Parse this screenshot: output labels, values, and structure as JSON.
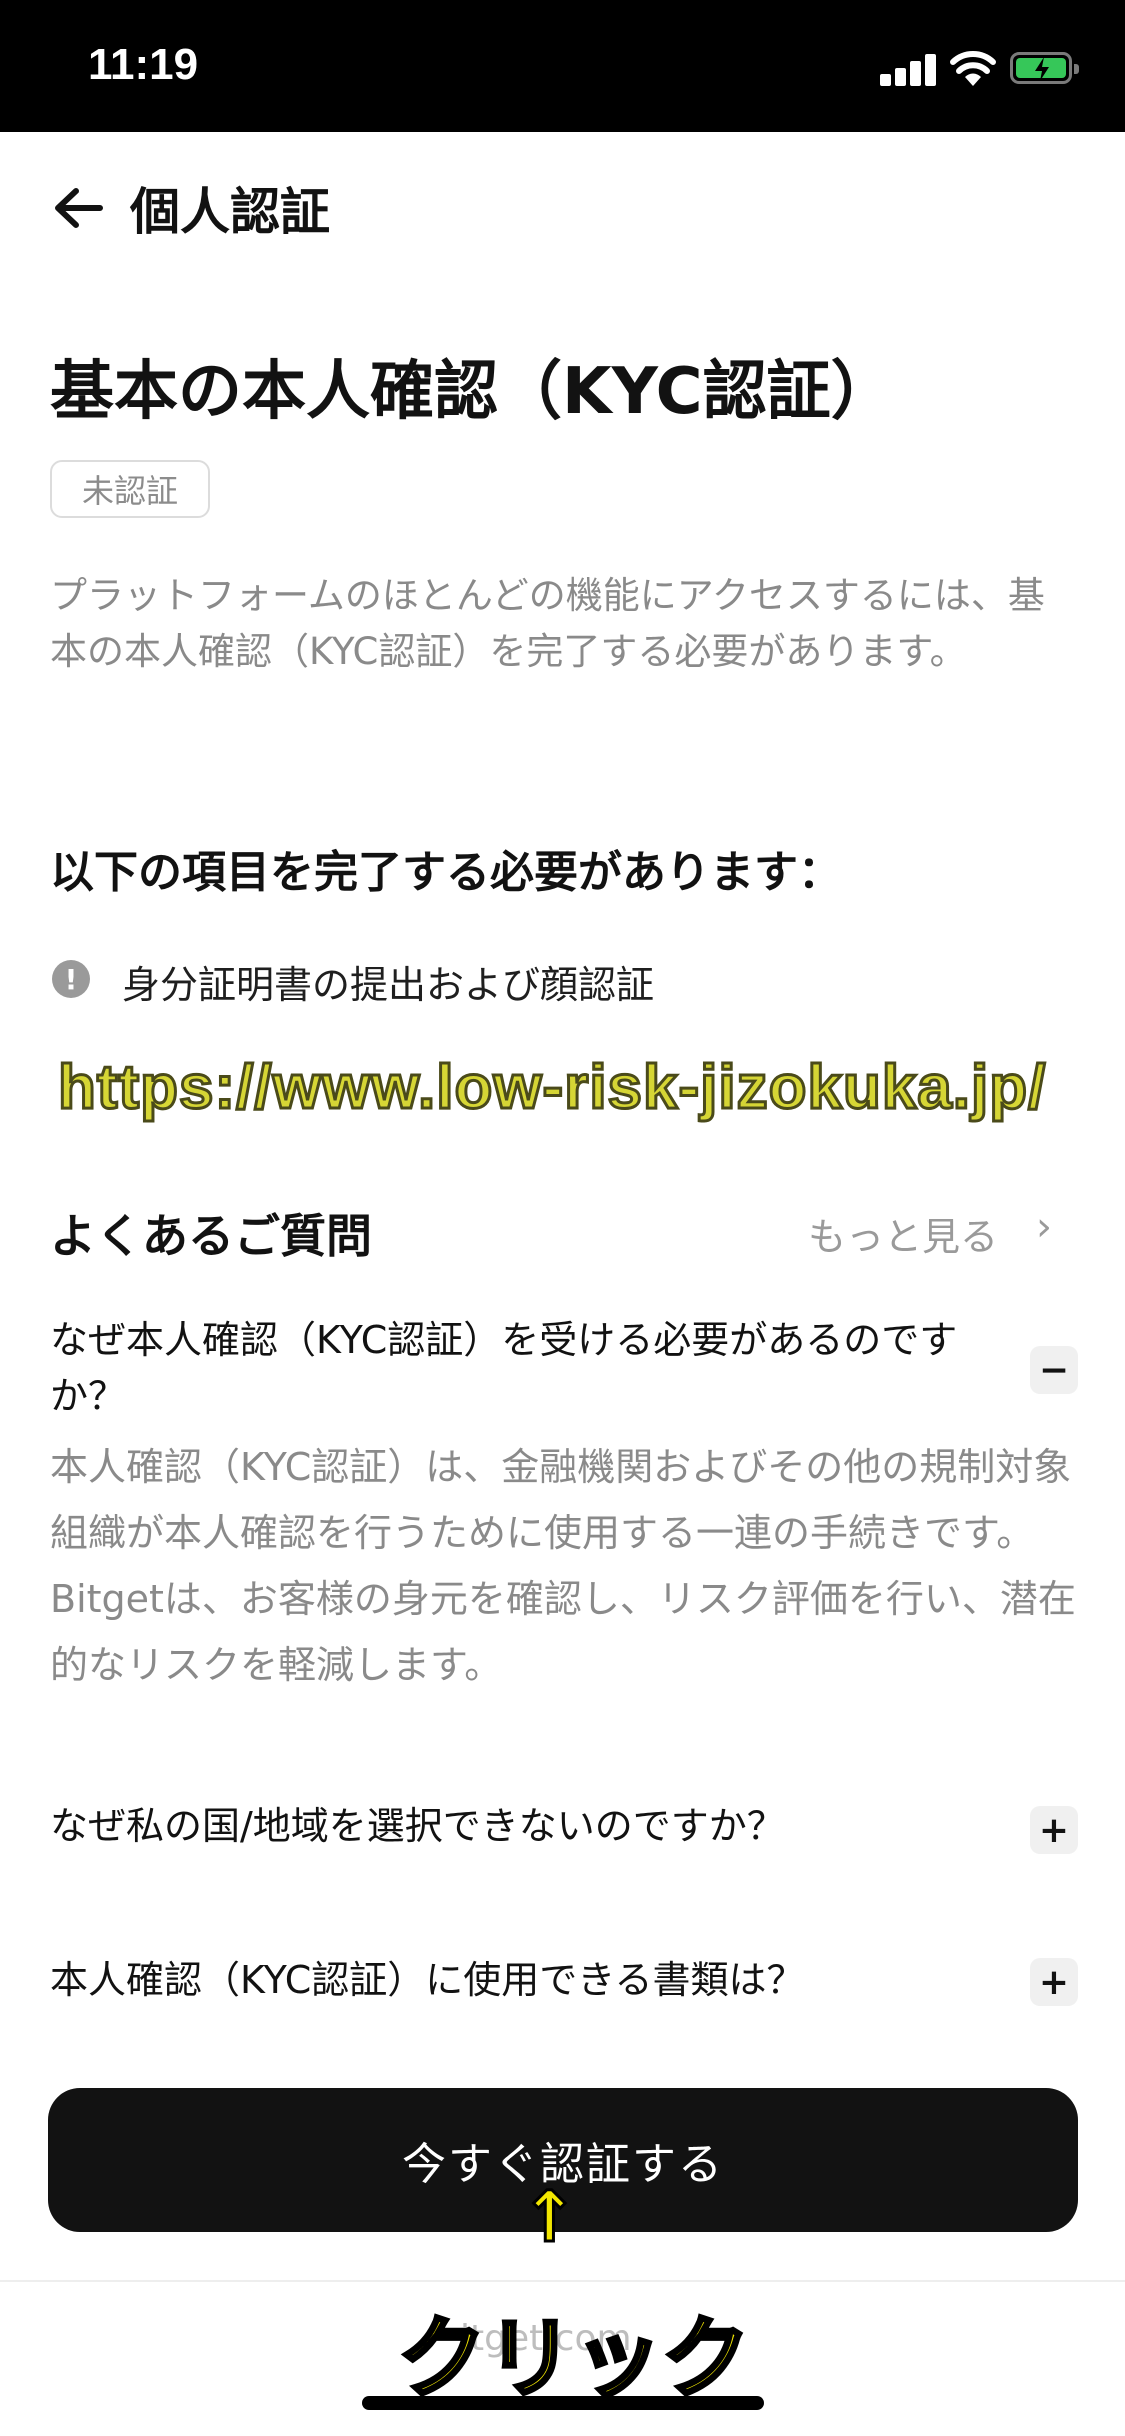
{
  "status_bar": {
    "time": "11:19"
  },
  "header": {
    "title": "個人認証"
  },
  "main": {
    "title": "基本の本人確認（KYC認証）",
    "status_badge": "未認証",
    "description": "プラットフォームのほとんどの機能にアクセスするには、基本の本人確認（KYC認証）を完了する必要があります。"
  },
  "requirements": {
    "heading": "以下の項目を完了する必要があります：",
    "items": [
      {
        "label": "身分証明書の提出および顔認証"
      }
    ]
  },
  "watermark": "https://www.low-risk-jizokuka.jp/",
  "faq": {
    "heading": "よくあるご質問",
    "more_label": "もっと見る",
    "items": [
      {
        "question": "なぜ本人確認（KYC認証）を受ける必要があるのですか？",
        "answer": "本人確認（KYC認証）は、金融機関およびその他の規制対象組織が本人確認を行うために使用する一連の手続きです。Bitgetは、お客様の身元を確認し、リスク評価を行い、潜在的なリスクを軽減します。",
        "toggle": "−"
      },
      {
        "question": "なぜ私の国/地域を選択できないのですか？",
        "toggle": "+"
      },
      {
        "question": "本人確認（KYC認証）に使用できる書類は？",
        "toggle": "+"
      }
    ]
  },
  "cta": {
    "label": "今すぐ認証する"
  },
  "footer": {
    "text": "itget.com"
  },
  "annotation": {
    "arrow": "↑",
    "label": "クリック"
  },
  "colors": {
    "cta_bg": "#121212",
    "watermark": "#d6d635",
    "annotation": "#f2e600"
  }
}
